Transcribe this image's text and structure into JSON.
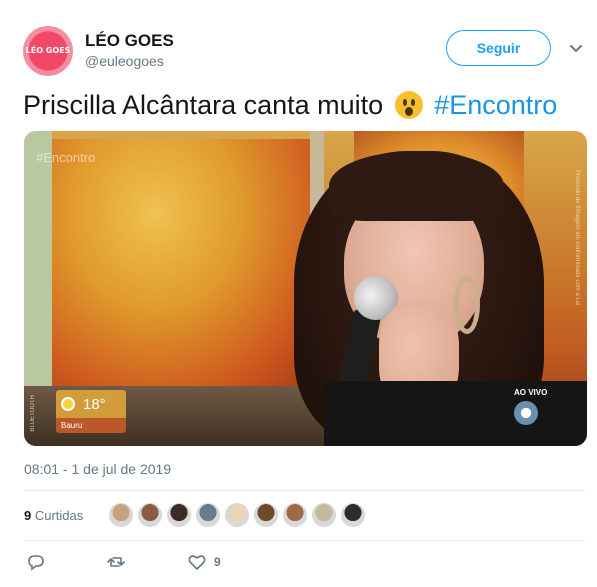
{
  "user": {
    "name": "LÉO GOES",
    "handle": "@euleogoes",
    "avatar_text": "LÉO GOES"
  },
  "follow_label": "Seguir",
  "tweet": {
    "text": "Priscilla Alcântara canta muito",
    "emoji": "hushed-face-emoji",
    "hashtag": "#Encontro"
  },
  "media": {
    "watermark": "#Encontro",
    "weather_temp": "18°",
    "weather_city": "Bauru",
    "live_label": "AO VIVO",
    "side_text": "Protocolo de filmagem em conformidade com a Lei",
    "side_text_left": "BLUETOOTH"
  },
  "timestamp": "08:01 - 1 de jul de 2019",
  "stats": {
    "likes": "9",
    "likes_label": "Curtidas"
  },
  "liker_avatars": [
    "#c9a17f",
    "#8a5c45",
    "#3b2a26",
    "#6d7b86",
    "#e8d6b3",
    "#6e4a2c",
    "#a06a4a",
    "#c9b8a0",
    "#2d2d2d"
  ],
  "actions": {
    "like_count": "9"
  },
  "colors": {
    "accent": "#1da1f2",
    "hashtag": "#1b95e0",
    "muted": "#657786"
  }
}
